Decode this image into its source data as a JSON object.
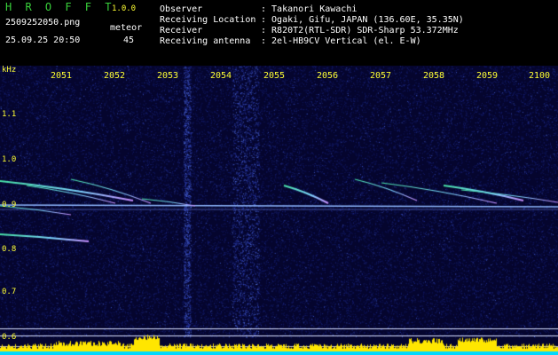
{
  "header": {
    "logo": "H R O F F T",
    "version": "1.0.0",
    "filename": "2509252050.png",
    "timestamp": "25.09.25 20:50",
    "meteor_label": "meteor",
    "meteor_count": "45",
    "info_labels": [
      "Observer",
      "Receiving Location",
      "Receiver",
      "Receiving antenna"
    ],
    "info_values": [
      ": Takanori Kawachi",
      ": Ogaki, Gifu, JAPAN (136.60E, 35.35N)",
      ": R820T2(RTL-SDR) SDR-Sharp 53.372MHz",
      ": 2el-HB9CV Vertical (el. E-W)"
    ]
  },
  "axes": {
    "y_unit": "kHz",
    "y_ticks": [
      "1.1",
      "1.0",
      "0.9",
      "0.8",
      "0.7",
      "0.6"
    ],
    "x_ticks": [
      "2051",
      "2052",
      "2053",
      "2054",
      "2055",
      "2056",
      "2057",
      "2058",
      "2059",
      "2100"
    ]
  },
  "colors": {
    "background": "#000000",
    "noise_base": "#07073a",
    "axis_text": "#ffff33",
    "logo_green": "#39d13b",
    "meteor_trail": "#7dd3ff",
    "envelope_yellow": "#ffe600",
    "envelope_cyan": "#00d8ff"
  }
}
